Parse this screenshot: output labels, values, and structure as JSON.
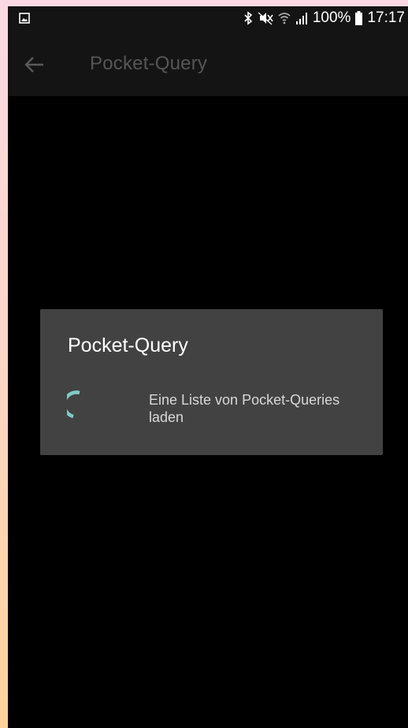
{
  "statusbar": {
    "battery_text": "100%",
    "time": "17:17",
    "icons": [
      "image-notification-icon",
      "bluetooth-icon",
      "mute-icon",
      "wifi-icon",
      "signal-icon",
      "battery-icon"
    ]
  },
  "appbar": {
    "title": "Pocket-Query",
    "back_icon": "arrow-left-icon"
  },
  "dialog": {
    "title": "Pocket-Query",
    "message": "Eine Liste von Pocket-Queries laden",
    "spinner_color": "#80cbc4"
  },
  "colors": {
    "background": "#000000",
    "toolbar": "#141414",
    "dialog_bg": "#424242",
    "accent": "#80cbc4"
  }
}
